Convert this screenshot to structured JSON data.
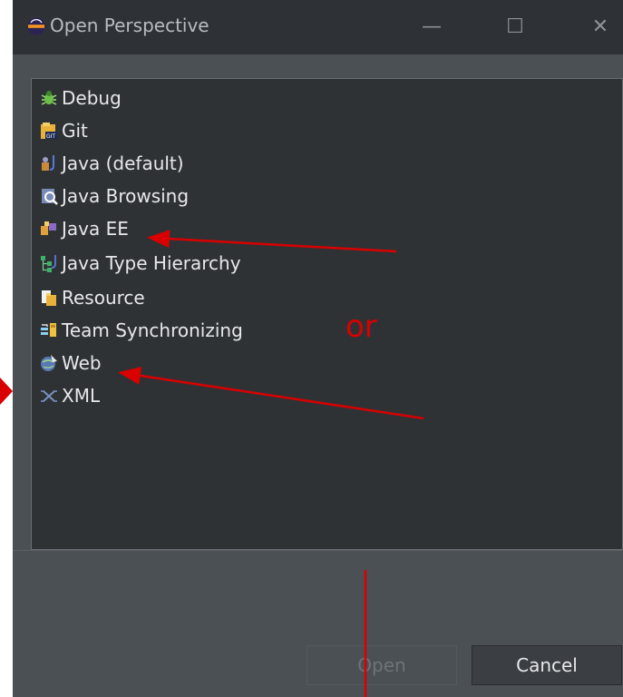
{
  "window": {
    "title": "Open Perspective",
    "min_glyph": "—",
    "max_glyph": "☐",
    "close_glyph": "✕"
  },
  "perspectives": [
    {
      "label": "Debug",
      "icon": "debug-bug-icon"
    },
    {
      "label": "Git",
      "icon": "git-icon"
    },
    {
      "label": "Java (default)",
      "icon": "java-icon"
    },
    {
      "label": "Java Browsing",
      "icon": "java-browsing-icon"
    },
    {
      "label": "Java EE",
      "icon": "java-ee-icon"
    },
    {
      "label": "Java Type Hierarchy",
      "icon": "type-hierarchy-icon"
    },
    {
      "label": "Resource",
      "icon": "resource-icon"
    },
    {
      "label": "Team Synchronizing",
      "icon": "team-sync-icon"
    },
    {
      "label": "Web",
      "icon": "web-icon"
    },
    {
      "label": "XML",
      "icon": "xml-icon"
    }
  ],
  "buttons": {
    "open_label": "Open",
    "cancel_label": "Cancel"
  },
  "annotation": {
    "text": "or",
    "color": "#d80000"
  }
}
